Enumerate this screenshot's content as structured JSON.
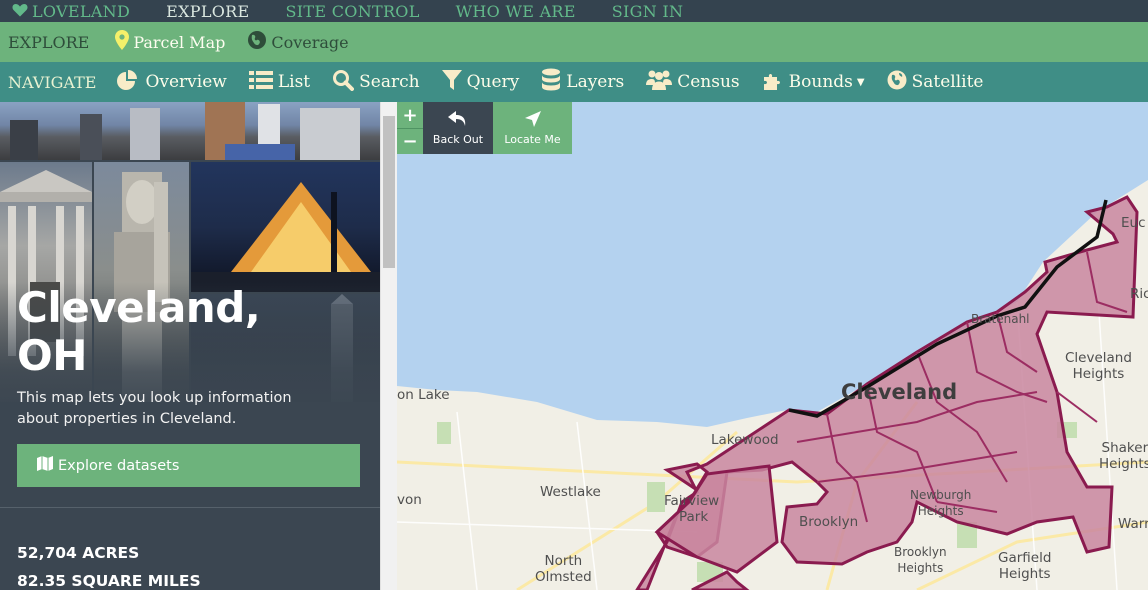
{
  "top_nav": {
    "brand": "LOVELAND",
    "items": [
      {
        "label": "EXPLORE",
        "active": true
      },
      {
        "label": "SITE CONTROL",
        "active": false
      },
      {
        "label": "WHO WE ARE",
        "active": false
      },
      {
        "label": "SIGN IN",
        "active": false
      }
    ]
  },
  "explore_bar": {
    "label": "EXPLORE",
    "items": [
      {
        "label": "Parcel Map",
        "icon": "map-pin-icon"
      },
      {
        "label": "Coverage",
        "icon": "globe-icon"
      }
    ]
  },
  "navigate_bar": {
    "label": "NAVIGATE",
    "items": [
      {
        "label": "Overview",
        "icon": "pie-chart-icon"
      },
      {
        "label": "List",
        "icon": "list-icon"
      },
      {
        "label": "Search",
        "icon": "search-icon"
      },
      {
        "label": "Query",
        "icon": "filter-icon"
      },
      {
        "label": "Layers",
        "icon": "database-icon"
      },
      {
        "label": "Census",
        "icon": "users-icon"
      },
      {
        "label": "Bounds",
        "icon": "puzzle-icon"
      },
      {
        "label": "Satellite",
        "icon": "globe-icon"
      }
    ]
  },
  "sidebar": {
    "city_line1": "Cleveland,",
    "city_line2": "OH",
    "description": "This map lets you look up information about properties in Cleveland.",
    "explore_button": "Explore datasets",
    "stats": [
      "52,704 ACRES",
      "82.35 SQUARE MILES"
    ]
  },
  "map": {
    "zoom_in": "+",
    "zoom_out": "−",
    "back_out": "Back Out",
    "locate_me": "Locate Me",
    "labels": {
      "cleveland": "Cleveland",
      "lakewood": "Lakewood",
      "westlake": "Westlake",
      "fairview_park_1": "Fairview",
      "fairview_park_2": "Park",
      "brooklyn": "Brooklyn",
      "brooklyn_heights_1": "Brooklyn",
      "brooklyn_heights_2": "Heights",
      "newburgh_1": "Newburgh",
      "newburgh_2": "Heights",
      "garfield_1": "Garfield",
      "garfield_2": "Heights",
      "cleveland_heights_1": "Cleveland",
      "cleveland_heights_2": "Heights",
      "shaker_1": "Shaker",
      "shaker_2": "Heights",
      "north_olmsted_1": "North",
      "north_olmsted_2": "Olmsted",
      "bratenahl": "Bratenahl",
      "avon_lake": "on Lake",
      "avon": "von",
      "euclid": "Euc",
      "richmond": "Ric",
      "warrensville": "Warr"
    }
  },
  "colors": {
    "topbar": "#34434f",
    "green": "#6db37c",
    "teal": "#3f8e86",
    "sidebar": "#3b4651",
    "lake": "#b3d1ee",
    "parcel_fill": "#c9869f",
    "parcel_border": "#8a1b4f"
  }
}
